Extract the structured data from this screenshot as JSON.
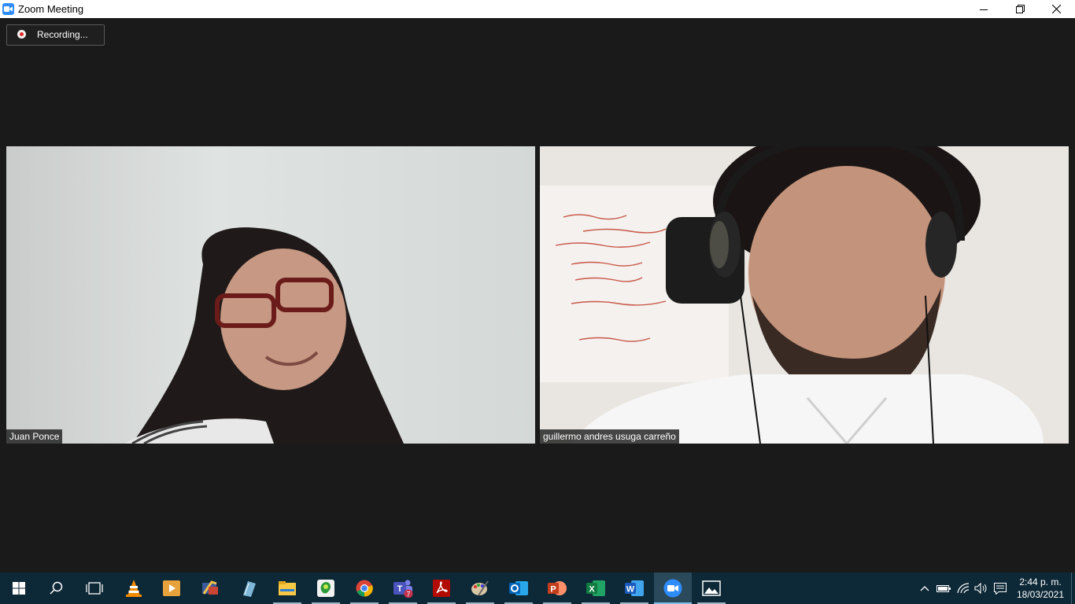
{
  "window": {
    "title": "Zoom Meeting",
    "controls": [
      "minimize-icon",
      "restore-icon",
      "close-icon"
    ]
  },
  "recording": {
    "label": "Recording..."
  },
  "participants": [
    {
      "name": "Juan Ponce"
    },
    {
      "name": "guillermo andres usuga carreño"
    }
  ],
  "taskbar": {
    "items": [
      {
        "icon": "windows-start-icon"
      },
      {
        "icon": "search-icon"
      },
      {
        "icon": "task-view-icon"
      },
      {
        "icon": "vlc-icon"
      },
      {
        "icon": "media-player-icon"
      },
      {
        "icon": "video-editor-icon"
      },
      {
        "icon": "notes-icon"
      },
      {
        "icon": "file-explorer-icon"
      },
      {
        "icon": "green-app-icon"
      },
      {
        "icon": "chrome-icon"
      },
      {
        "icon": "teams-icon",
        "badge": "7"
      },
      {
        "icon": "acrobat-icon"
      },
      {
        "icon": "paint-icon"
      },
      {
        "icon": "outlook-icon"
      },
      {
        "icon": "powerpoint-icon"
      },
      {
        "icon": "excel-icon"
      },
      {
        "icon": "word-icon"
      },
      {
        "icon": "zoom-icon",
        "active": true
      },
      {
        "icon": "photos-icon"
      }
    ],
    "tray": [
      "chevron-up-icon",
      "battery-icon",
      "wifi-icon",
      "volume-icon",
      "notification-icon"
    ],
    "time": "2:44 p. m.",
    "date": "18/03/2021"
  },
  "colors": {
    "meeting_bg": "#1a1a1a",
    "taskbar_bg": "#0d2836",
    "zoom_blue": "#2d8cff",
    "recording_red": "#e02828"
  }
}
